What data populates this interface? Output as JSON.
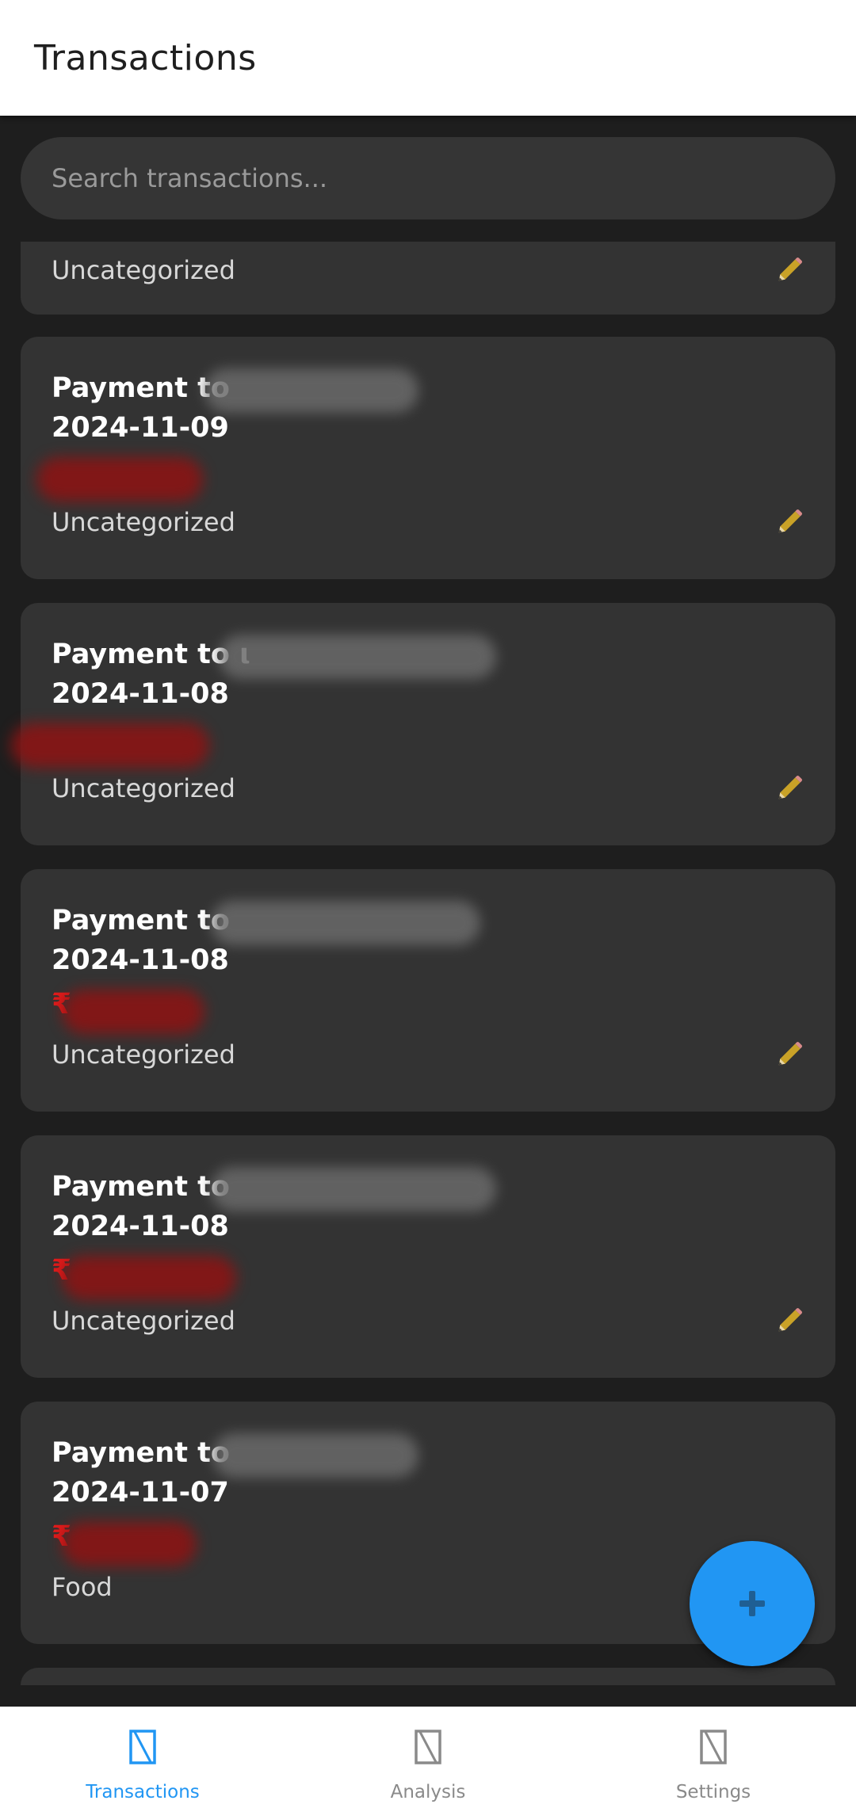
{
  "appbar": {
    "title": "Transactions"
  },
  "search": {
    "placeholder": "Search transactions..."
  },
  "transactions": [
    {
      "category": "Uncategorized"
    },
    {
      "title": "Payment to",
      "date": "2024-11-09",
      "amount": "",
      "category": "Uncategorized"
    },
    {
      "title": "Payment to ι",
      "date": "2024-11-08",
      "amount": "",
      "category": "Uncategorized"
    },
    {
      "title": "Payment to",
      "date": "2024-11-08",
      "amount": "₹",
      "category": "Uncategorized"
    },
    {
      "title": "Payment to",
      "date": "2024-11-08",
      "amount": "₹",
      "category": "Uncategorized"
    },
    {
      "title": "Payment to",
      "date": "2024-11-07",
      "amount": "₹",
      "category": "Food"
    }
  ],
  "fab": {
    "icon": "plus-icon"
  },
  "bottom_nav": {
    "items": [
      {
        "label": "Transactions",
        "icon": "transactions-icon",
        "active": true
      },
      {
        "label": "Analysis",
        "icon": "analysis-icon",
        "active": false
      },
      {
        "label": "Settings",
        "icon": "settings-icon",
        "active": false
      }
    ]
  },
  "colors": {
    "accent": "#2196f3",
    "amount": "#e21b1b",
    "card": "#333333",
    "background": "#1e1e1e",
    "edit_icon": "#c9a227"
  }
}
